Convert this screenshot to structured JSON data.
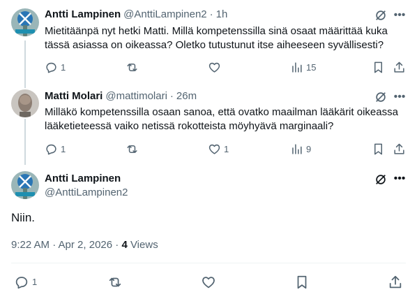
{
  "tweets": [
    {
      "name": "Antti Lampinen",
      "handle": "@AnttiLampinen2",
      "time": "1h",
      "text": "Mietitäänpä nyt hetki Matti. Millä kompetenssilla sinä osaat määrittää kuka tässä asiassa on oikeassa? Oletko tutustunut itse aiheeseen syvällisesti?",
      "replies": "1",
      "likes": "",
      "views": "15"
    },
    {
      "name": "Matti Molari",
      "handle": "@mattimolari",
      "time": "26m",
      "text": "Milläkö kompetenssilla osaan sanoa, että ovatko maailman lääkärit oikeassa lääketieteessä vaiko netissä rokotteista möyhyävä marginaali?",
      "replies": "1",
      "likes": "1",
      "views": "9"
    }
  ],
  "main_tweet": {
    "name": "Antti Lampinen",
    "handle": "@AnttiLampinen2",
    "text": "Niin.",
    "timestamp": "9:22 AM · Apr 2, 2026",
    "views_count": "4",
    "views_label": "Views",
    "replies": "1"
  },
  "colors": {
    "text_primary": "#0f1419",
    "text_secondary": "#536471",
    "thread_line": "#cfd9de"
  }
}
